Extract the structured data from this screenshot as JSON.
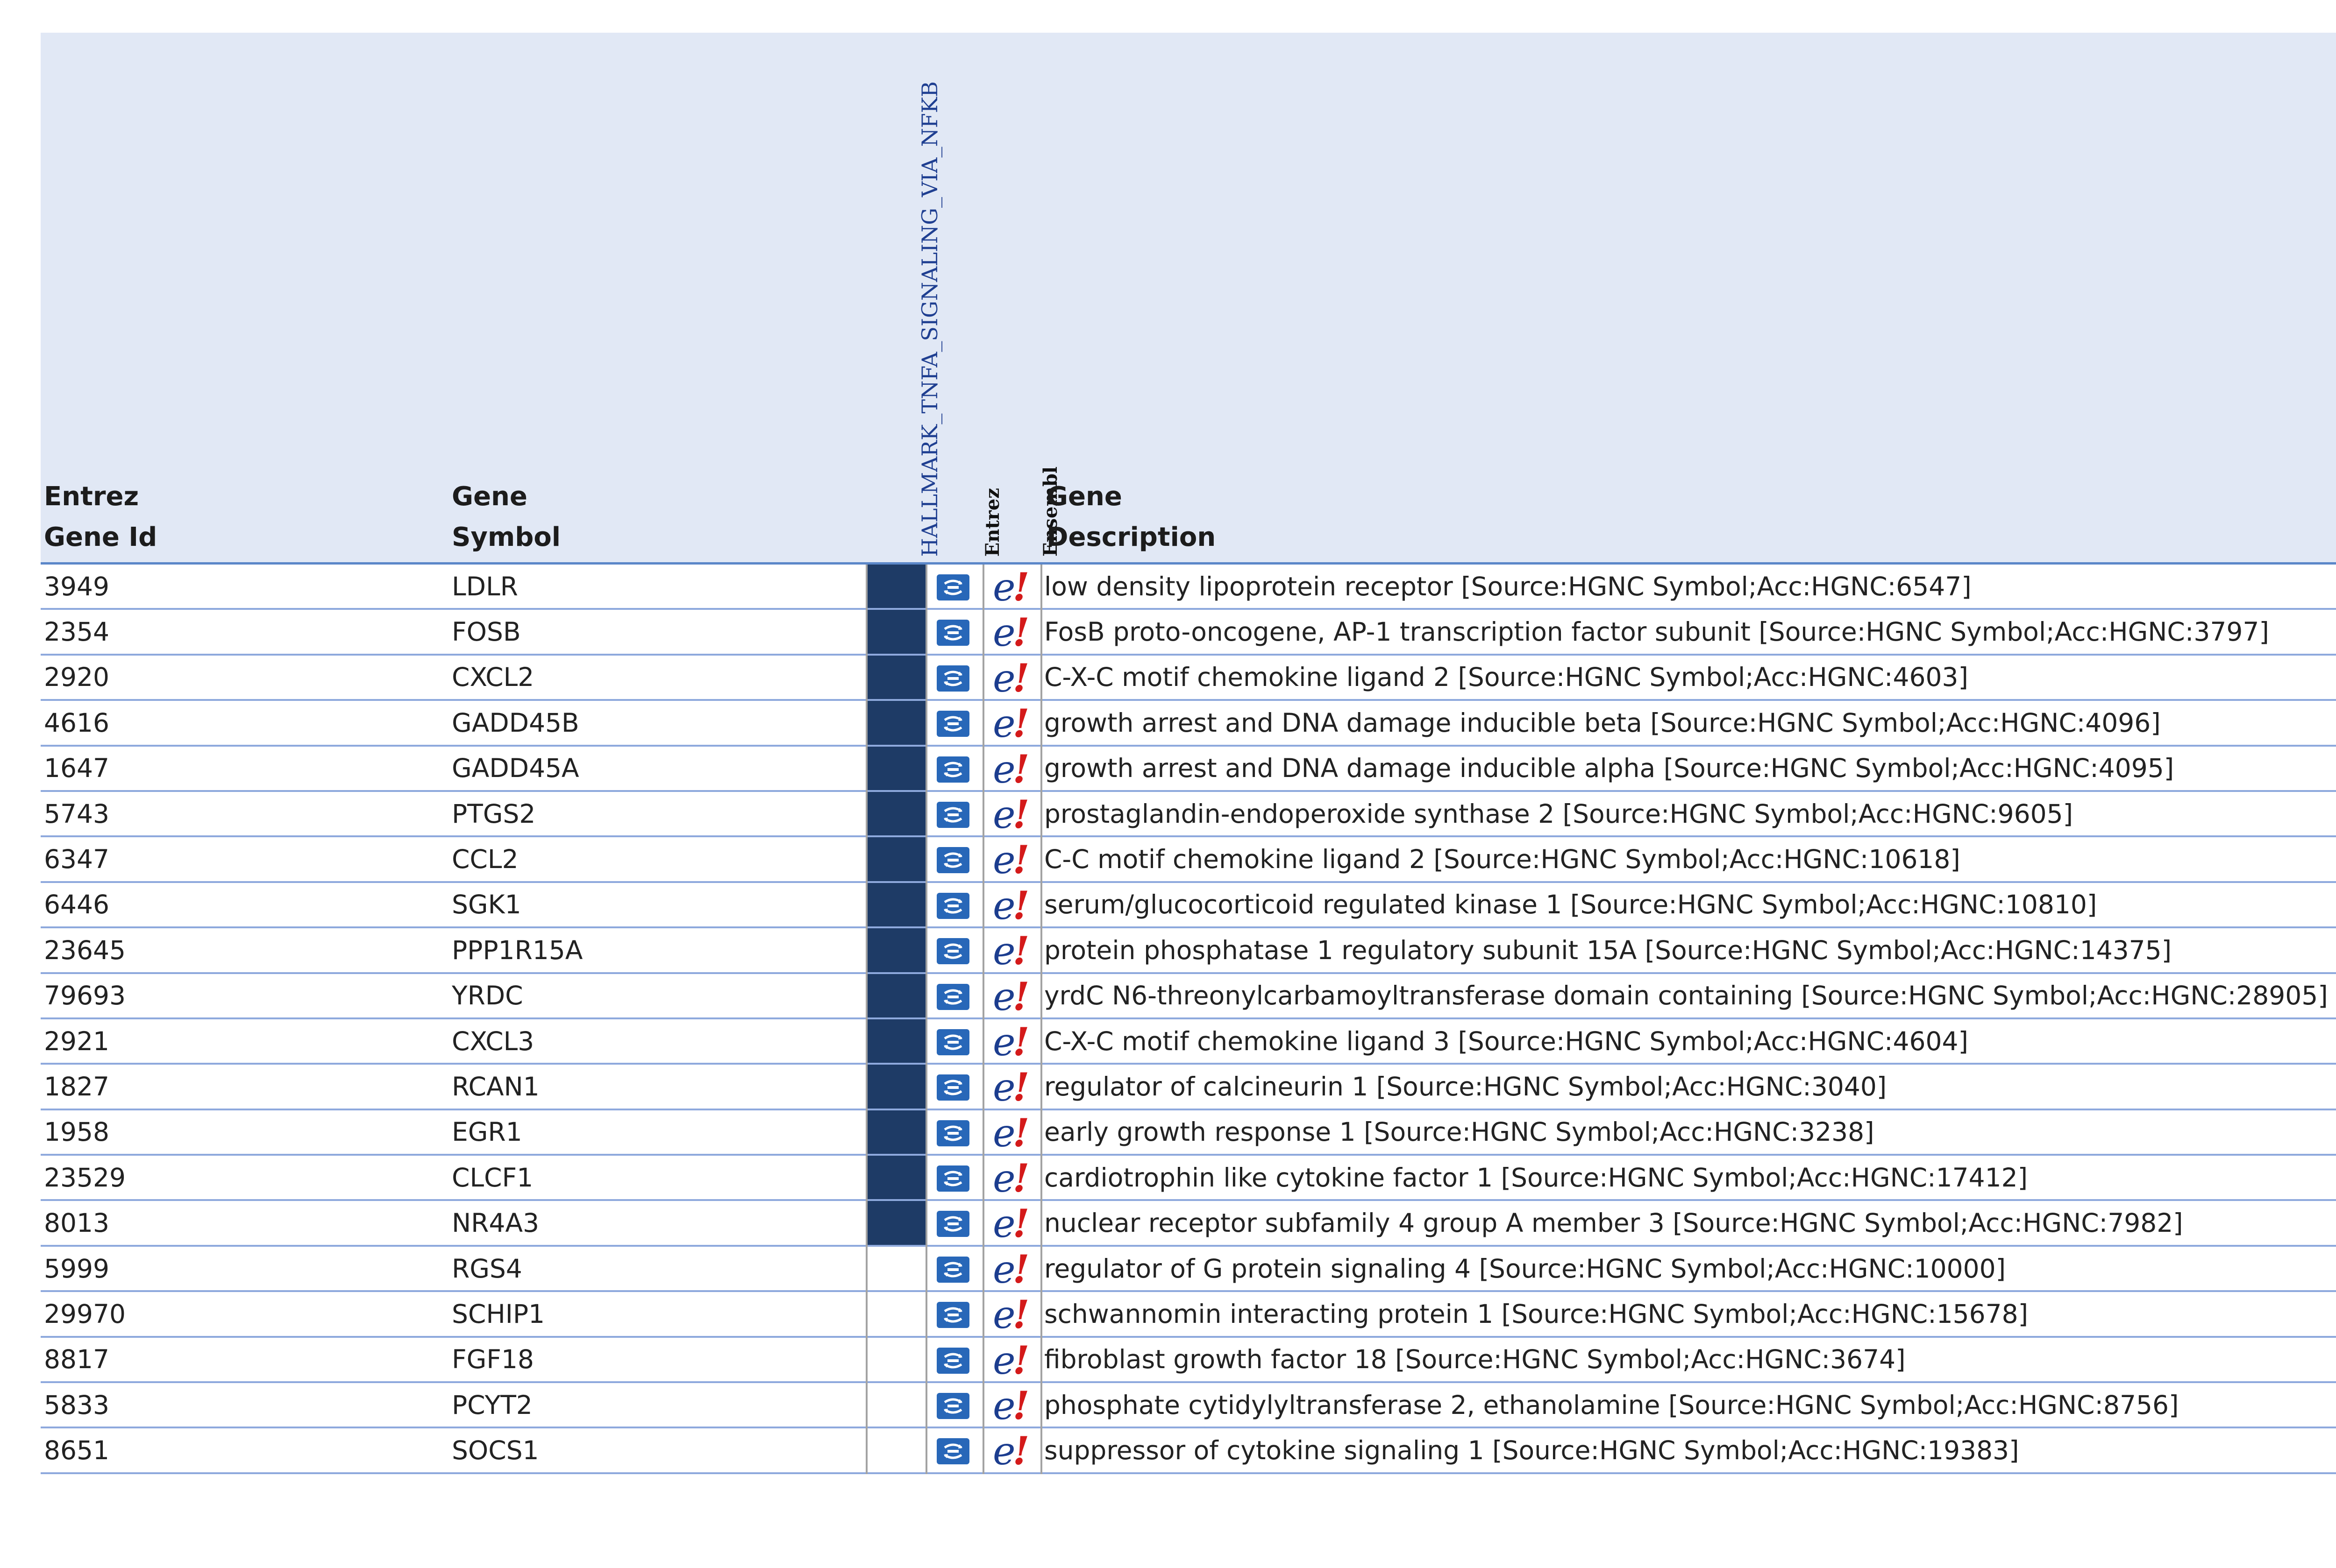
{
  "table": {
    "headers": {
      "entrez_line1": "Entrez",
      "entrez_line2": "Gene Id",
      "symbol_line1": "Gene",
      "symbol_line2": "Symbol",
      "geneset": "HALLMARK_TNFA_SIGNALING_VIA_NFKB",
      "entrez_link": "Entrez",
      "ensembl_link": "Ensembl",
      "desc_line1": "Gene",
      "desc_line2": "Description"
    },
    "rows": [
      {
        "id": "3949",
        "symbol": "LDLR",
        "in_set": true,
        "desc": "low density lipoprotein receptor [Source:HGNC Symbol;Acc:HGNC:6547]"
      },
      {
        "id": "2354",
        "symbol": "FOSB",
        "in_set": true,
        "desc": "FosB proto-oncogene, AP-1 transcription factor subunit [Source:HGNC Symbol;Acc:HGNC:3797]"
      },
      {
        "id": "2920",
        "symbol": "CXCL2",
        "in_set": true,
        "desc": "C-X-C motif chemokine ligand 2 [Source:HGNC Symbol;Acc:HGNC:4603]"
      },
      {
        "id": "4616",
        "symbol": "GADD45B",
        "in_set": true,
        "desc": "growth arrest and DNA damage inducible beta [Source:HGNC Symbol;Acc:HGNC:4096]"
      },
      {
        "id": "1647",
        "symbol": "GADD45A",
        "in_set": true,
        "desc": "growth arrest and DNA damage inducible alpha [Source:HGNC Symbol;Acc:HGNC:4095]"
      },
      {
        "id": "5743",
        "symbol": "PTGS2",
        "in_set": true,
        "desc": "prostaglandin-endoperoxide synthase 2 [Source:HGNC Symbol;Acc:HGNC:9605]"
      },
      {
        "id": "6347",
        "symbol": "CCL2",
        "in_set": true,
        "desc": "C-C motif chemokine ligand 2 [Source:HGNC Symbol;Acc:HGNC:10618]"
      },
      {
        "id": "6446",
        "symbol": "SGK1",
        "in_set": true,
        "desc": "serum/glucocorticoid regulated kinase 1 [Source:HGNC Symbol;Acc:HGNC:10810]"
      },
      {
        "id": "23645",
        "symbol": "PPP1R15A",
        "in_set": true,
        "desc": "protein phosphatase 1 regulatory subunit 15A [Source:HGNC Symbol;Acc:HGNC:14375]"
      },
      {
        "id": "79693",
        "symbol": "YRDC",
        "in_set": true,
        "desc": "yrdC N6-threonylcarbamoyltransferase domain containing [Source:HGNC Symbol;Acc:HGNC:28905]"
      },
      {
        "id": "2921",
        "symbol": "CXCL3",
        "in_set": true,
        "desc": "C-X-C motif chemokine ligand 3 [Source:HGNC Symbol;Acc:HGNC:4604]"
      },
      {
        "id": "1827",
        "symbol": "RCAN1",
        "in_set": true,
        "desc": "regulator of calcineurin 1 [Source:HGNC Symbol;Acc:HGNC:3040]"
      },
      {
        "id": "1958",
        "symbol": "EGR1",
        "in_set": true,
        "desc": "early growth response 1 [Source:HGNC Symbol;Acc:HGNC:3238]"
      },
      {
        "id": "23529",
        "symbol": "CLCF1",
        "in_set": true,
        "desc": "cardiotrophin like cytokine factor 1 [Source:HGNC Symbol;Acc:HGNC:17412]"
      },
      {
        "id": "8013",
        "symbol": "NR4A3",
        "in_set": true,
        "desc": "nuclear receptor subfamily 4 group A member 3 [Source:HGNC Symbol;Acc:HGNC:7982]"
      },
      {
        "id": "5999",
        "symbol": "RGS4",
        "in_set": false,
        "desc": "regulator of G protein signaling 4 [Source:HGNC Symbol;Acc:HGNC:10000]"
      },
      {
        "id": "29970",
        "symbol": "SCHIP1",
        "in_set": false,
        "desc": "schwannomin interacting protein 1 [Source:HGNC Symbol;Acc:HGNC:15678]"
      },
      {
        "id": "8817",
        "symbol": "FGF18",
        "in_set": false,
        "desc": "fibroblast growth factor 18 [Source:HGNC Symbol;Acc:HGNC:3674]"
      },
      {
        "id": "5833",
        "symbol": "PCYT2",
        "in_set": false,
        "desc": "phosphate cytidylyltransferase 2, ethanolamine [Source:HGNC Symbol;Acc:HGNC:8756]"
      },
      {
        "id": "8651",
        "symbol": "SOCS1",
        "in_set": false,
        "desc": "suppressor of cytokine signaling 1 [Source:HGNC Symbol;Acc:HGNC:19383]"
      }
    ]
  },
  "icons": {
    "entrez": "entrez-link-icon",
    "ensembl": "ensembl-link-icon",
    "ensembl_glyph": "e",
    "ensembl_mark": "!"
  },
  "colors": {
    "header_bg": "#e1e8f5",
    "set_member_fill": "#1e3b66",
    "row_border": "#8ea9dd",
    "entrez_icon": "#2867b8",
    "ensembl_e": "#1c3d8f",
    "ensembl_mark": "#d41a1a"
  }
}
